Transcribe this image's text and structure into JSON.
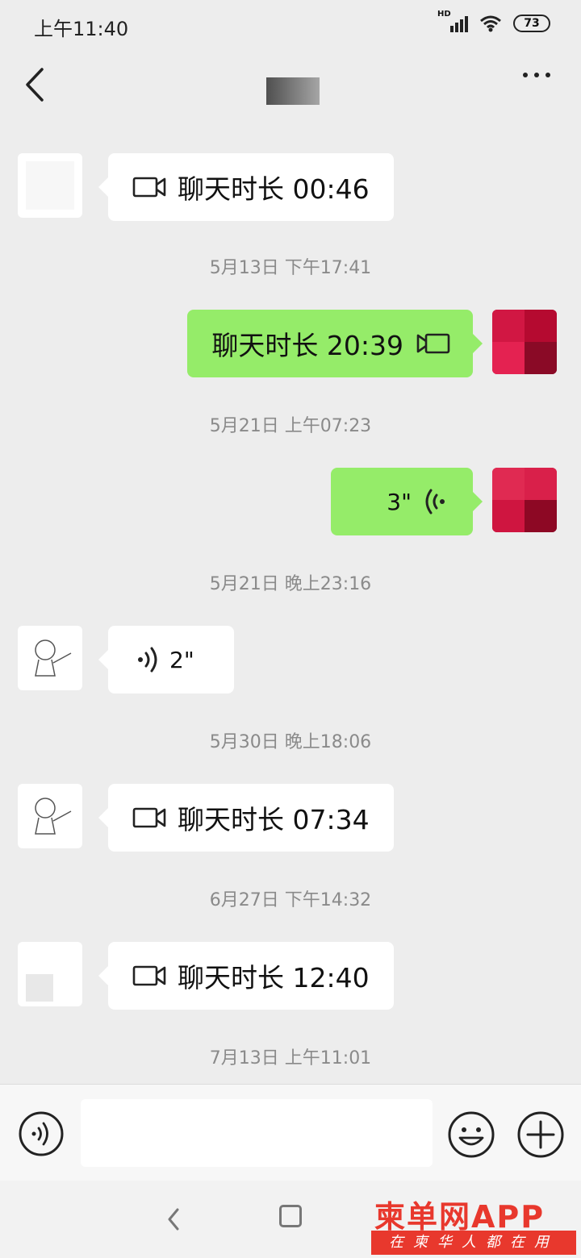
{
  "status_bar": {
    "time": "上午11:40",
    "network": "HD",
    "battery": "73"
  },
  "nav": {
    "title": ""
  },
  "messages": [
    {
      "side": "in",
      "type": "video-call",
      "text": "聊天时长 00:46"
    },
    {
      "timestamp": "5月13日 下午17:41"
    },
    {
      "side": "out",
      "type": "video-call",
      "text": "聊天时长 20:39"
    },
    {
      "timestamp": "5月21日 上午07:23"
    },
    {
      "side": "out",
      "type": "voice",
      "text": "3\""
    },
    {
      "timestamp": "5月21日 晚上23:16"
    },
    {
      "side": "in",
      "type": "voice",
      "text": "2\""
    },
    {
      "timestamp": "5月30日 晚上18:06"
    },
    {
      "side": "in",
      "type": "video-call",
      "text": "聊天时长 07:34"
    },
    {
      "timestamp": "6月27日 下午14:32"
    },
    {
      "side": "in",
      "type": "video-call",
      "text": "聊天时长 12:40"
    },
    {
      "timestamp": "7月13日 上午11:01"
    }
  ],
  "bubbles": {
    "m1": "聊天时长 00:46",
    "m2": "聊天时长 20:39",
    "m3": "3\"",
    "m4": "2\"",
    "m5": "聊天时长 07:34",
    "m6": "聊天时长 12:40"
  },
  "timestamps": {
    "t1": "5月13日 下午17:41",
    "t2": "5月21日 上午07:23",
    "t3": "5月21日 晚上23:16",
    "t4": "5月30日 晚上18:06",
    "t5": "6月27日 下午14:32",
    "t6": "7月13日 上午11:01"
  },
  "input_bar": {
    "placeholder": ""
  },
  "watermark": {
    "logo": "柬单网APP",
    "slogan": "在柬华人都在用"
  },
  "colors": {
    "outgoing_bubble": "#95ec69",
    "incoming_bubble": "#ffffff",
    "background": "#ededed",
    "watermark": "#e8382d"
  }
}
